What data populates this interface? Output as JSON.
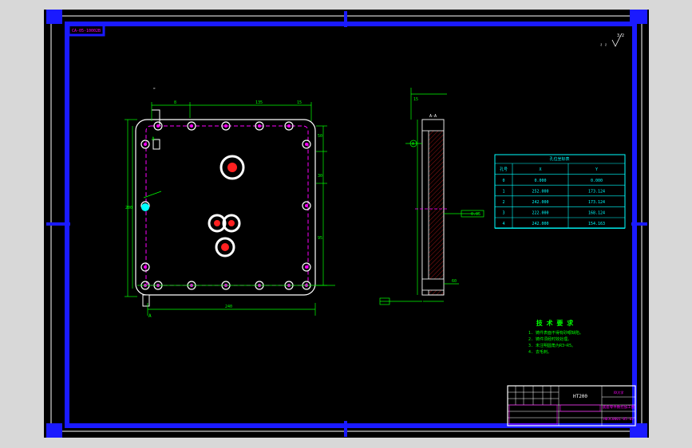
{
  "colors": {
    "background": "#000000",
    "frame": "#1a1aff",
    "outline": "#ffffff",
    "dimension": "#00ff00",
    "centerline": "#ff00ff",
    "hatch": "#ff2020",
    "hole": "#ff00ff",
    "table": "#00ffff",
    "title_block": "#ff00ff",
    "window_bg": "#d8d8d8"
  },
  "top_left_tag": "CA-05-10002B",
  "surface_finish_note": "3.2",
  "front_view": {
    "dims": {
      "top_left": "8",
      "top_right": "135",
      "top_right2": "15",
      "left_height": "200",
      "right_1": "50",
      "right_2": "30",
      "right_3": "95",
      "bottom": "240"
    },
    "section_mark_top": "A",
    "section_mark_bottom": "A",
    "datum": "A"
  },
  "side_view": {
    "section_label": "A-A",
    "datum_label": "A",
    "tolerance_value": "0.05",
    "dim_top": "15",
    "dim_bottom": "60"
  },
  "coord_table": {
    "title": "孔位坐标表",
    "headers": [
      "孔号",
      "X",
      "Y"
    ],
    "rows": [
      [
        "0",
        "0.000",
        "0.000"
      ],
      [
        "1",
        "252.000",
        "173.124"
      ],
      [
        "2",
        "242.000",
        "173.124"
      ],
      [
        "3",
        "222.000",
        "168.124"
      ],
      [
        "4",
        "242.000",
        "154.163"
      ]
    ]
  },
  "tech_requirements": {
    "title": "技 术 要 求",
    "items": [
      "1. 铸件表面不得有砂眼缺陷。",
      "2. 铸件须经时效处理。",
      "3. 未注明圆角为R3~R5。",
      "4. 去毛刺。"
    ]
  },
  "title_block": {
    "material": "HT200",
    "drawing_name": "底座零件数控加工图",
    "drawing_number": "HDJC0601-05-02",
    "company": "XX大学"
  }
}
